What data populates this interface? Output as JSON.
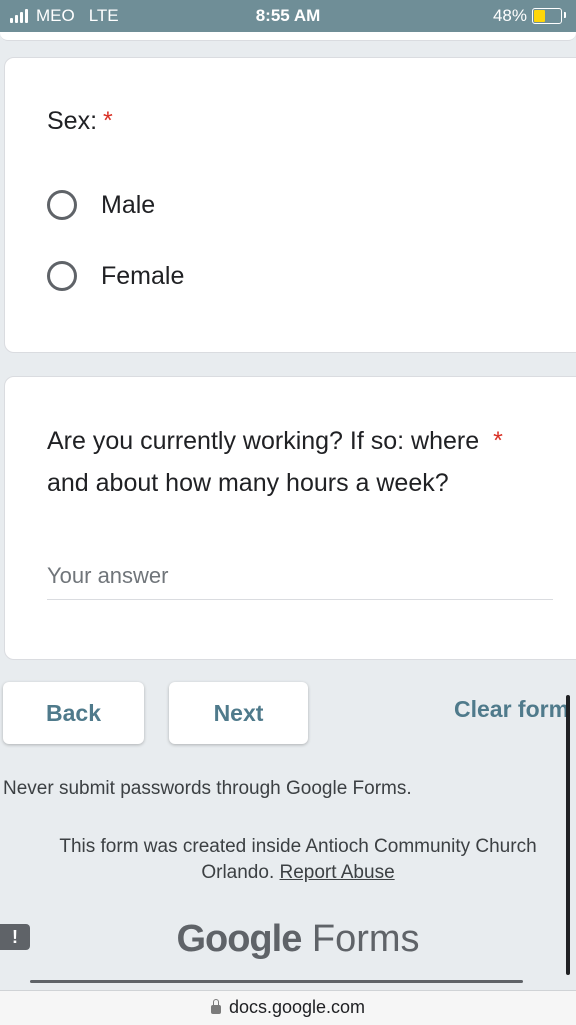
{
  "status_bar": {
    "carrier": "MEO",
    "network": "LTE",
    "time": "8:55 AM",
    "battery": "48%"
  },
  "questions": [
    {
      "title": "Sex:",
      "required_mark": "*",
      "options": [
        "Male",
        "Female"
      ]
    },
    {
      "title_line1": "Are you currently working? If so: where",
      "title_line2": "and about how many hours a week?",
      "required_mark": "*",
      "placeholder": "Your answer"
    }
  ],
  "nav": {
    "back_label": "Back",
    "next_label": "Next",
    "clear_label": "Clear form"
  },
  "footer": {
    "warning": "Never submit passwords through Google Forms.",
    "created_line1": "This form was created inside Antioch Community Church",
    "created_line2": "Orlando.",
    "report_link": "Report Abuse",
    "brand_google": "Google",
    "brand_forms": "Forms"
  },
  "browser": {
    "url": "docs.google.com"
  },
  "colors": {
    "status_bar": "#6f8e97",
    "required": "#d93025",
    "button_text": "#4f7a8b"
  }
}
